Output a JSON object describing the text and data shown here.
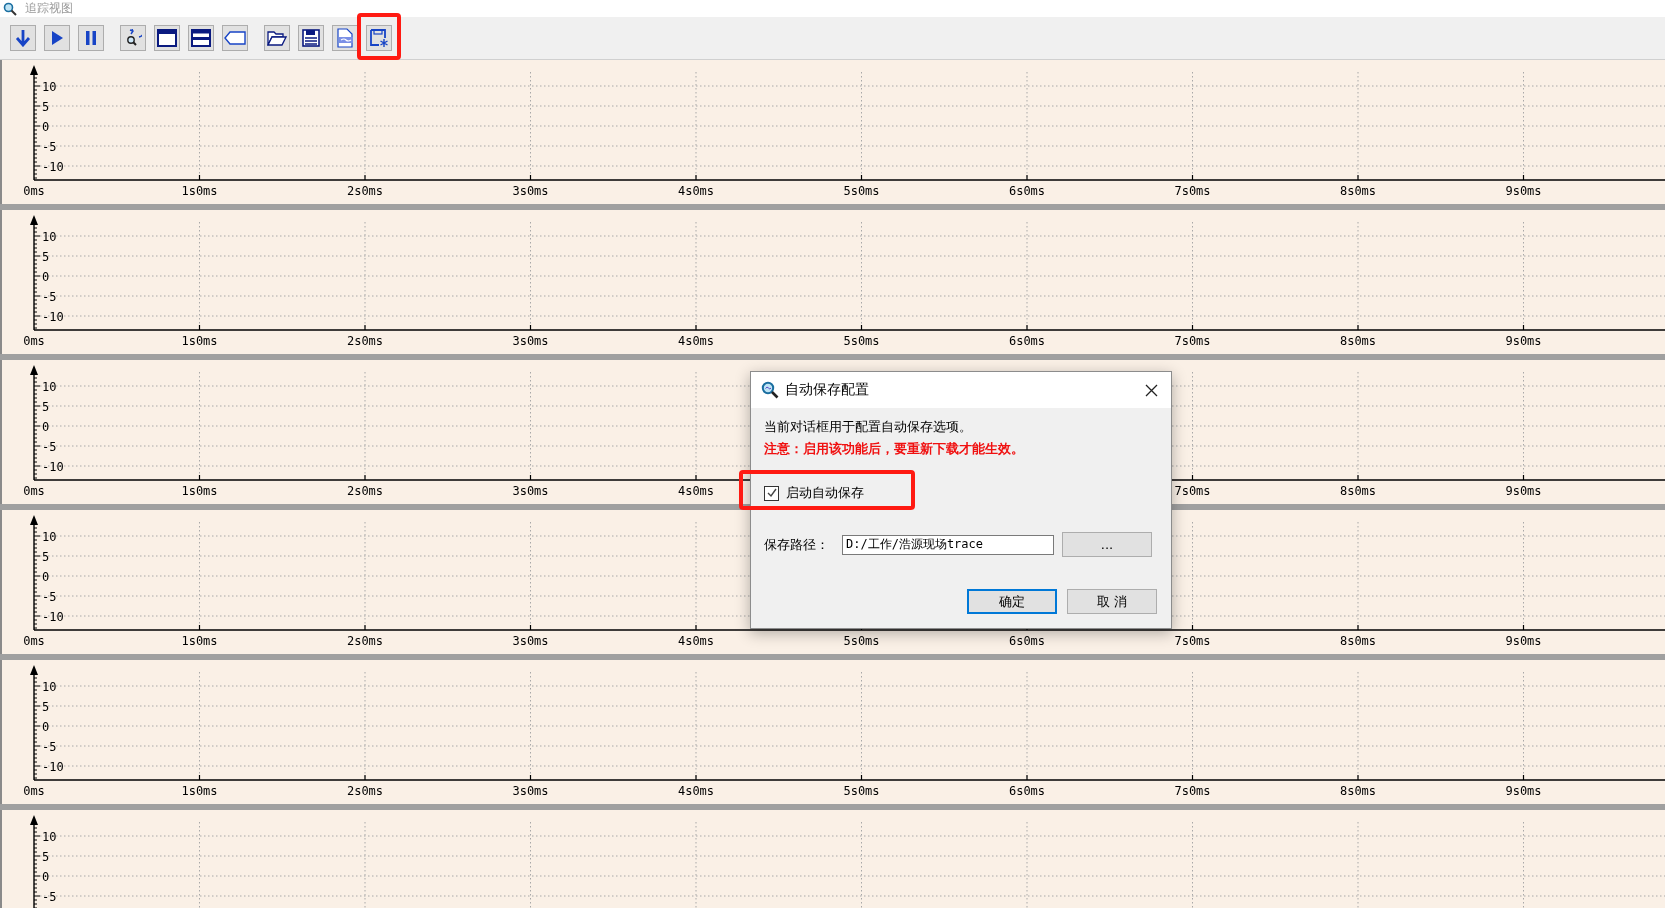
{
  "window": {
    "title": "追踪视图"
  },
  "toolbar": {
    "groups": [
      [
        {
          "kind": "down",
          "annotated": false
        },
        {
          "kind": "play",
          "annotated": false
        },
        {
          "kind": "pause",
          "annotated": false
        }
      ],
      [
        {
          "kind": "zoom-reset",
          "annotated": false
        },
        {
          "kind": "window",
          "annotated": false
        },
        {
          "kind": "split",
          "annotated": false
        },
        {
          "kind": "tag",
          "annotated": false
        }
      ],
      [
        {
          "kind": "open",
          "annotated": false
        },
        {
          "kind": "save",
          "annotated": false
        },
        {
          "kind": "csv",
          "annotated": false
        },
        {
          "kind": "autosave",
          "annotated": true
        }
      ]
    ]
  },
  "panels": [
    {
      "chart_data": {
        "type": "line",
        "categories": [
          "0ms",
          "1s0ms",
          "2s0ms",
          "3s0ms",
          "4s0ms",
          "5s0ms",
          "6s0ms",
          "7s0ms",
          "8s0ms",
          "9s0ms"
        ],
        "ylim": [
          -13.5,
          14.5
        ],
        "yticks": [
          10,
          5,
          0,
          -5,
          -10
        ],
        "grid": true
      }
    },
    {
      "chart_data": {
        "type": "line",
        "categories": [
          "0ms",
          "1s0ms",
          "2s0ms",
          "3s0ms",
          "4s0ms",
          "5s0ms",
          "6s0ms",
          "7s0ms",
          "8s0ms",
          "9s0ms"
        ],
        "ylim": [
          -13.5,
          14.5
        ],
        "yticks": [
          10,
          5,
          0,
          -5,
          -10
        ],
        "grid": true
      }
    },
    {
      "chart_data": {
        "type": "line",
        "categories": [
          "0ms",
          "1s0ms",
          "2s0ms",
          "3s0ms",
          "4s0ms",
          null,
          null,
          "7s0ms",
          "8s0ms",
          "9s0ms"
        ],
        "ylim": [
          -13.5,
          14.5
        ],
        "yticks": [
          10,
          5,
          0,
          -5,
          -10
        ],
        "grid": true
      }
    },
    {
      "chart_data": {
        "type": "line",
        "categories": [
          "0ms",
          "1s0ms",
          "2s0ms",
          "3s0ms",
          "4s0ms",
          "5s0ms",
          "6s0ms",
          "7s0ms",
          "8s0ms",
          "9s0ms"
        ],
        "ylim": [
          -13.5,
          14.5
        ],
        "yticks": [
          10,
          5,
          0,
          -5,
          -10
        ],
        "grid": true
      }
    },
    {
      "chart_data": {
        "type": "line",
        "categories": [
          "0ms",
          "1s0ms",
          "2s0ms",
          "3s0ms",
          "4s0ms",
          "5s0ms",
          "6s0ms",
          "7s0ms",
          "8s0ms",
          "9s0ms"
        ],
        "ylim": [
          -13.5,
          14.5
        ],
        "yticks": [
          10,
          5,
          0,
          -5,
          -10
        ],
        "grid": true
      }
    },
    {
      "chart_data": {
        "type": "line",
        "categories": [
          null,
          null,
          null,
          null,
          null,
          null,
          null,
          null,
          null,
          null
        ],
        "ylim": [
          -13.5,
          14.5
        ],
        "yticks": [
          10,
          5,
          0,
          -5
        ],
        "grid": true
      }
    }
  ],
  "dialog": {
    "title": "自动保存配置",
    "message": "当前对话框用于配置自动保存选项。",
    "warning": "注意：启用该功能后，要重新下载才能生效。",
    "checkbox": {
      "label": "启动自动保存",
      "checked": true,
      "annotated": true
    },
    "path": {
      "label": "保存路径：",
      "value": "D:/工作/浩源现场trace"
    },
    "browse_button": "...",
    "buttons": [
      {
        "label": "确定",
        "default": true
      },
      {
        "label": "取 消",
        "default": false
      }
    ]
  }
}
